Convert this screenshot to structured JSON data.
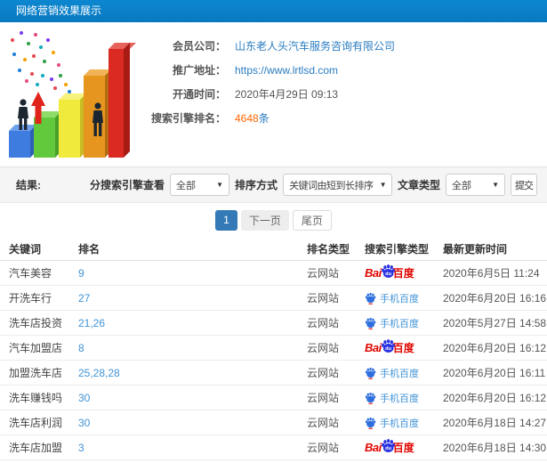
{
  "header": {
    "title": "网络营销效果展示"
  },
  "info": {
    "member_label": "会员公司：",
    "member_value": "山东老人头汽车服务咨询有限公司",
    "url_label": "推广地址：",
    "url_value": "https://www.lrtlsd.com",
    "open_label": "开通时间：",
    "open_value": "2020年4月29日 09:13",
    "rank_label": "搜索引擎排名：",
    "rank_count": "4648",
    "rank_unit": "条"
  },
  "filters": {
    "result_label": "结果:",
    "engine_filter_label": "分搜索引擎查看",
    "engine_filter_value": "全部",
    "sort_label": "排序方式",
    "sort_value": "关键词由短到长排序",
    "type_label": "文章类型",
    "type_value": "全部",
    "submit_label": "提交",
    "caret": "▼"
  },
  "pagination": {
    "current": "1",
    "next": "下一页",
    "last": "尾页"
  },
  "logos": {
    "baidu_bai": "Bai",
    "baidu_du": "du",
    "baidu_suffix": "百度",
    "shouji": "手机百度"
  },
  "table": {
    "headers": [
      "关键词",
      "排名",
      "排名类型",
      "搜索引擎类型",
      "最新更新时间"
    ],
    "rows": [
      {
        "keyword": "汽车美容",
        "rank": "9",
        "rank_type": "云网站",
        "engine": "baidu",
        "time": "2020年6月5日 11:24"
      },
      {
        "keyword": "开洗车行",
        "rank": "27",
        "rank_type": "云网站",
        "engine": "shouji",
        "time": "2020年6月20日 16:16"
      },
      {
        "keyword": "洗车店投资",
        "rank": "21,26",
        "rank_type": "云网站",
        "engine": "shouji",
        "time": "2020年5月27日 14:58"
      },
      {
        "keyword": "汽车加盟店",
        "rank": "8",
        "rank_type": "云网站",
        "engine": "baidu",
        "time": "2020年6月20日 16:12"
      },
      {
        "keyword": "加盟洗车店",
        "rank": "25,28,28",
        "rank_type": "云网站",
        "engine": "shouji",
        "time": "2020年6月20日 16:11"
      },
      {
        "keyword": "洗车赚钱吗",
        "rank": "30",
        "rank_type": "云网站",
        "engine": "shouji",
        "time": "2020年6月20日 16:12"
      },
      {
        "keyword": "洗车店利润",
        "rank": "30",
        "rank_type": "云网站",
        "engine": "shouji",
        "time": "2020年6月18日 14:27"
      },
      {
        "keyword": "洗车店加盟",
        "rank": "3",
        "rank_type": "云网站",
        "engine": "baidu",
        "time": "2020年6月18日 14:30"
      }
    ]
  },
  "colors": {
    "header_bg": "#0b83cd",
    "link": "#2a7cc0",
    "rank_link": "#4193d5",
    "accent_orange": "#ff6600",
    "pagination_active": "#337ab7",
    "baidu_red": "#e10601",
    "baidu_blue": "#2932e1"
  }
}
